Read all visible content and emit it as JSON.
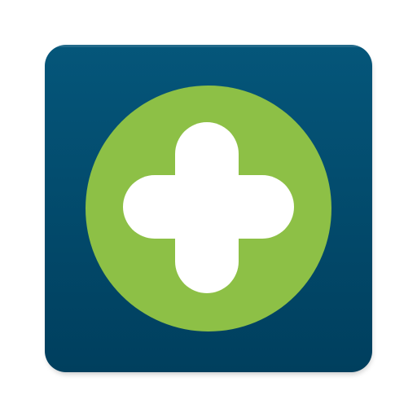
{
  "app_icon": {
    "name": "app-icon",
    "colors": {
      "tile_top": "#05567a",
      "tile_bottom": "#003f5e",
      "circle": "#8dc046",
      "cross": "#ffffff"
    },
    "icon_glyph": "plus-cross-icon"
  }
}
